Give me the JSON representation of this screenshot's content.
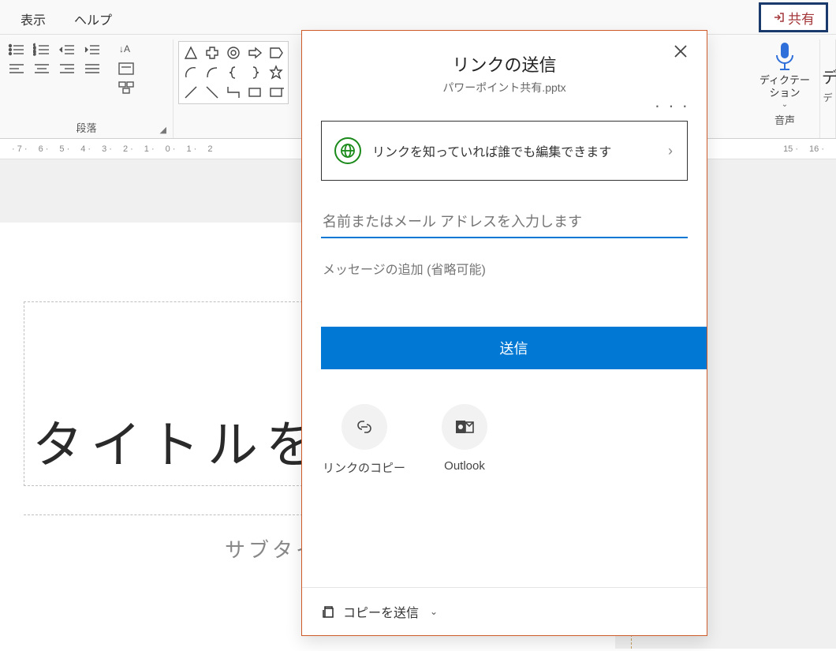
{
  "tabs": {
    "view": "表示",
    "help": "ヘルプ"
  },
  "share_button": "共有",
  "ribbon": {
    "paragraph_group": "段落",
    "voice_group": "音声",
    "dictation": "ディクテー\nション"
  },
  "ruler": [
    "7",
    "6",
    "5",
    "4",
    "3",
    "2",
    "1",
    "0",
    "1",
    "2",
    "15",
    "16"
  ],
  "slide": {
    "title_placeholder": "タイトルを",
    "subtitle_placeholder": "サブタイトルを"
  },
  "dialog": {
    "title": "リンクの送信",
    "filename": "パワーポイント共有.pptx",
    "link_scope": "リンクを知っていれば誰でも編集できます",
    "address_placeholder": "名前またはメール アドレスを入力します",
    "message_placeholder": "メッセージの追加 (省略可能)",
    "send": "送信",
    "copy_link": "リンクのコピー",
    "outlook": "Outlook",
    "send_copy": "コピーを送信"
  }
}
